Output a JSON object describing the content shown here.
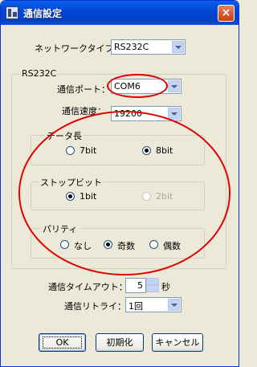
{
  "window": {
    "title": "通信設定",
    "close_glyph": "×"
  },
  "network_type": {
    "label": "ネットワークタイプ：",
    "value": "RS232C"
  },
  "rs232c_group": {
    "legend": "RS232C",
    "port": {
      "label": "通信ポート：",
      "value": "COM6"
    },
    "speed": {
      "label": "通信速度：",
      "value": "19200"
    },
    "data_length": {
      "legend": "データ長",
      "options": [
        {
          "label": "7bit",
          "checked": false
        },
        {
          "label": "8bit",
          "checked": true
        }
      ]
    },
    "stop_bit": {
      "legend": "ストップビット",
      "options": [
        {
          "label": "1bit",
          "checked": true
        },
        {
          "label": "2bit",
          "checked": false,
          "disabled": true
        }
      ]
    },
    "parity": {
      "legend": "パリティ",
      "options": [
        {
          "label": "なし",
          "checked": false
        },
        {
          "label": "奇数",
          "checked": true
        },
        {
          "label": "偶数",
          "checked": false
        }
      ]
    }
  },
  "timeout": {
    "label": "通信タイムアウト：",
    "value": "5",
    "unit": "秒"
  },
  "retry": {
    "label": "通信リトライ：",
    "value": "1回"
  },
  "buttons": {
    "ok": "OK",
    "init": "初期化",
    "cancel": "キャンセル"
  },
  "annotation_color": "#e00000"
}
